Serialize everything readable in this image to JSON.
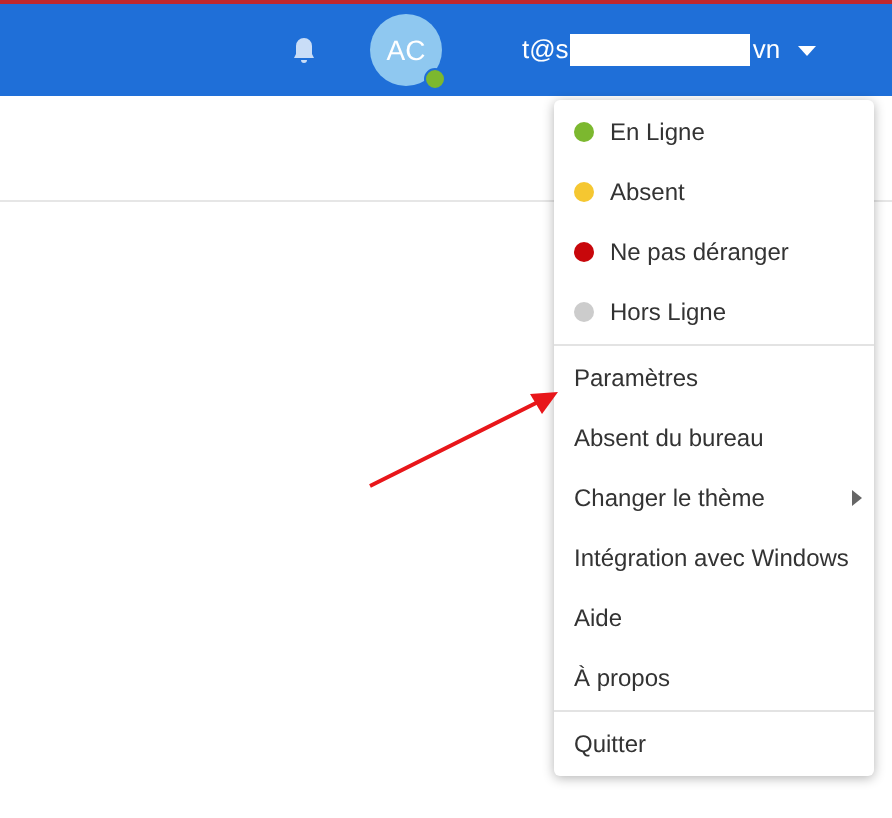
{
  "header": {
    "avatar_initials": "AC",
    "online": true,
    "email_start": "t@s",
    "email_end": "vn"
  },
  "status_menu": {
    "sections": [
      {
        "items": [
          {
            "kind": "status",
            "label": "En Ligne",
            "color": "#7cb82f"
          },
          {
            "kind": "status",
            "label": "Absent",
            "color": "#f5c731"
          },
          {
            "kind": "status",
            "label": "Ne pas déranger",
            "color": "#c8070b"
          },
          {
            "kind": "status",
            "label": "Hors Ligne",
            "color": "#cccccc"
          }
        ]
      },
      {
        "items": [
          {
            "kind": "action",
            "label": "Paramètres",
            "has_submenu": false
          },
          {
            "kind": "action",
            "label": "Absent du bureau",
            "has_submenu": false
          },
          {
            "kind": "action",
            "label": "Changer le thème",
            "has_submenu": true
          },
          {
            "kind": "action",
            "label": "Intégration avec Windows",
            "has_submenu": false
          },
          {
            "kind": "action",
            "label": "Aide",
            "has_submenu": false
          },
          {
            "kind": "action",
            "label": "À propos",
            "has_submenu": false
          }
        ]
      },
      {
        "items": [
          {
            "kind": "action",
            "label": "Quitter",
            "has_submenu": false
          }
        ]
      }
    ]
  }
}
